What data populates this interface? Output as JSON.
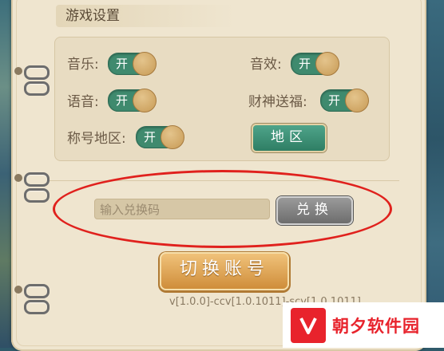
{
  "panel": {
    "title": "游戏设置"
  },
  "settings": {
    "music": {
      "label": "音乐:",
      "state": "开"
    },
    "sfx": {
      "label": "音效:",
      "state": "开"
    },
    "voice": {
      "label": "语音:",
      "state": "开"
    },
    "fortune": {
      "label": "财神送福:",
      "state": "开"
    },
    "title_region": {
      "label": "称号地区:",
      "state": "开"
    },
    "region_button": "地区"
  },
  "redeem": {
    "placeholder": "输入兑换码",
    "button": "兑换"
  },
  "switch_account": "切换账号",
  "version": "v[1.0.0]-ccv[1.0.1011]-scv[1.0.1011]",
  "watermark": {
    "text": "朝夕软件园"
  },
  "colors": {
    "toggle_on": "#3f8a6e",
    "highlight_ellipse": "#e0211d",
    "switch_button": "#e0a24f"
  }
}
